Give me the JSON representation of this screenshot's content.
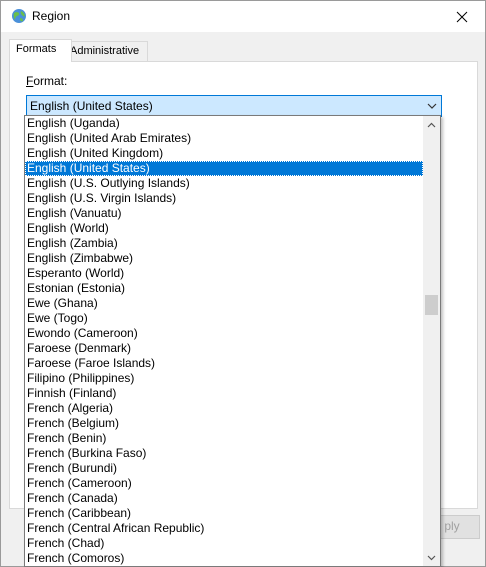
{
  "window": {
    "title": "Region"
  },
  "icons": {
    "app": "globe-icon",
    "close": "close-icon",
    "dropdown_arrow": "chevron-down-icon",
    "scroll_up": "chevron-up-icon",
    "scroll_down": "chevron-down-icon"
  },
  "tabs": [
    {
      "label": "Formats",
      "active": true
    },
    {
      "label": "Administrative",
      "active": false
    }
  ],
  "format": {
    "label_prefix": "F",
    "label_rest": "ormat:",
    "selected_value": "English (United States)"
  },
  "dropdown": {
    "items": [
      "English (Uganda)",
      "English (United Arab Emirates)",
      "English (United Kingdom)",
      "English (United States)",
      "English (U.S. Outlying Islands)",
      "English (U.S. Virgin Islands)",
      "English (Vanuatu)",
      "English (World)",
      "English (Zambia)",
      "English (Zimbabwe)",
      "Esperanto (World)",
      "Estonian (Estonia)",
      "Ewe (Ghana)",
      "Ewe (Togo)",
      "Ewondo (Cameroon)",
      "Faroese (Denmark)",
      "Faroese (Faroe Islands)",
      "Filipino (Philippines)",
      "Finnish (Finland)",
      "French (Algeria)",
      "French (Belgium)",
      "French (Benin)",
      "French (Burkina Faso)",
      "French (Burundi)",
      "French (Cameroon)",
      "French (Canada)",
      "French (Caribbean)",
      "French (Central African Republic)",
      "French (Chad)",
      "French (Comoros)"
    ],
    "selected_index": 3,
    "scroll_position": 0.41
  },
  "buttons": {
    "apply": "ply"
  },
  "colors": {
    "selection": "#0078d7",
    "combo_bg": "#cce8ff",
    "combo_border": "#0078d7"
  }
}
